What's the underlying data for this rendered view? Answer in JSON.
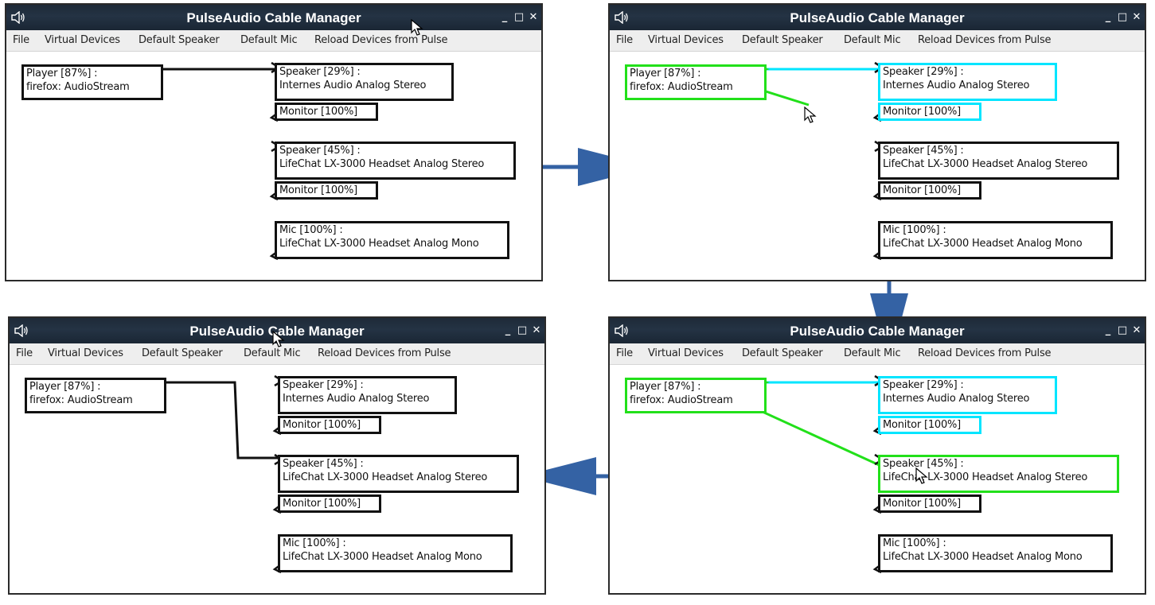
{
  "app": {
    "title": "PulseAudio Cable Manager",
    "window_controls": {
      "minimize": "_",
      "maximize": "□",
      "close": "✕"
    }
  },
  "menu": [
    "File",
    "Virtual Devices",
    "Default Speaker",
    "Default Mic",
    "Reload Devices from Pulse"
  ],
  "nodes": {
    "player": {
      "line1": "Player [87%] :",
      "line2": "firefox: AudioStream"
    },
    "speaker1": {
      "line1": "Speaker [29%] :",
      "line2": "Internes Audio Analog Stereo"
    },
    "monitor1": {
      "line1": "Monitor [100%]"
    },
    "speaker2": {
      "line1": "Speaker [45%] :",
      "line2": "LifeChat LX-3000 Headset Analog Stereo"
    },
    "monitor2": {
      "line1": "Monitor [100%]"
    },
    "mic": {
      "line1": "Mic [100%] :",
      "line2": "LifeChat LX-3000 Headset Analog Mono"
    }
  },
  "colors": {
    "titlebar": "#1e2a38",
    "node_border": "#111111",
    "highlight_connected": "#00e5ff",
    "highlight_drag": "#22e01a",
    "flow_arrow": "#3462a4"
  },
  "steps": [
    {
      "step": 1,
      "connected": "speaker1",
      "dragging": false,
      "drag_target": null
    },
    {
      "step": 2,
      "connected": "speaker1",
      "dragging": true,
      "drag_target": null
    },
    {
      "step": 3,
      "connected": "speaker1",
      "dragging": true,
      "drag_target": "speaker2"
    },
    {
      "step": 4,
      "connected": "speaker2",
      "dragging": false,
      "drag_target": null
    }
  ]
}
